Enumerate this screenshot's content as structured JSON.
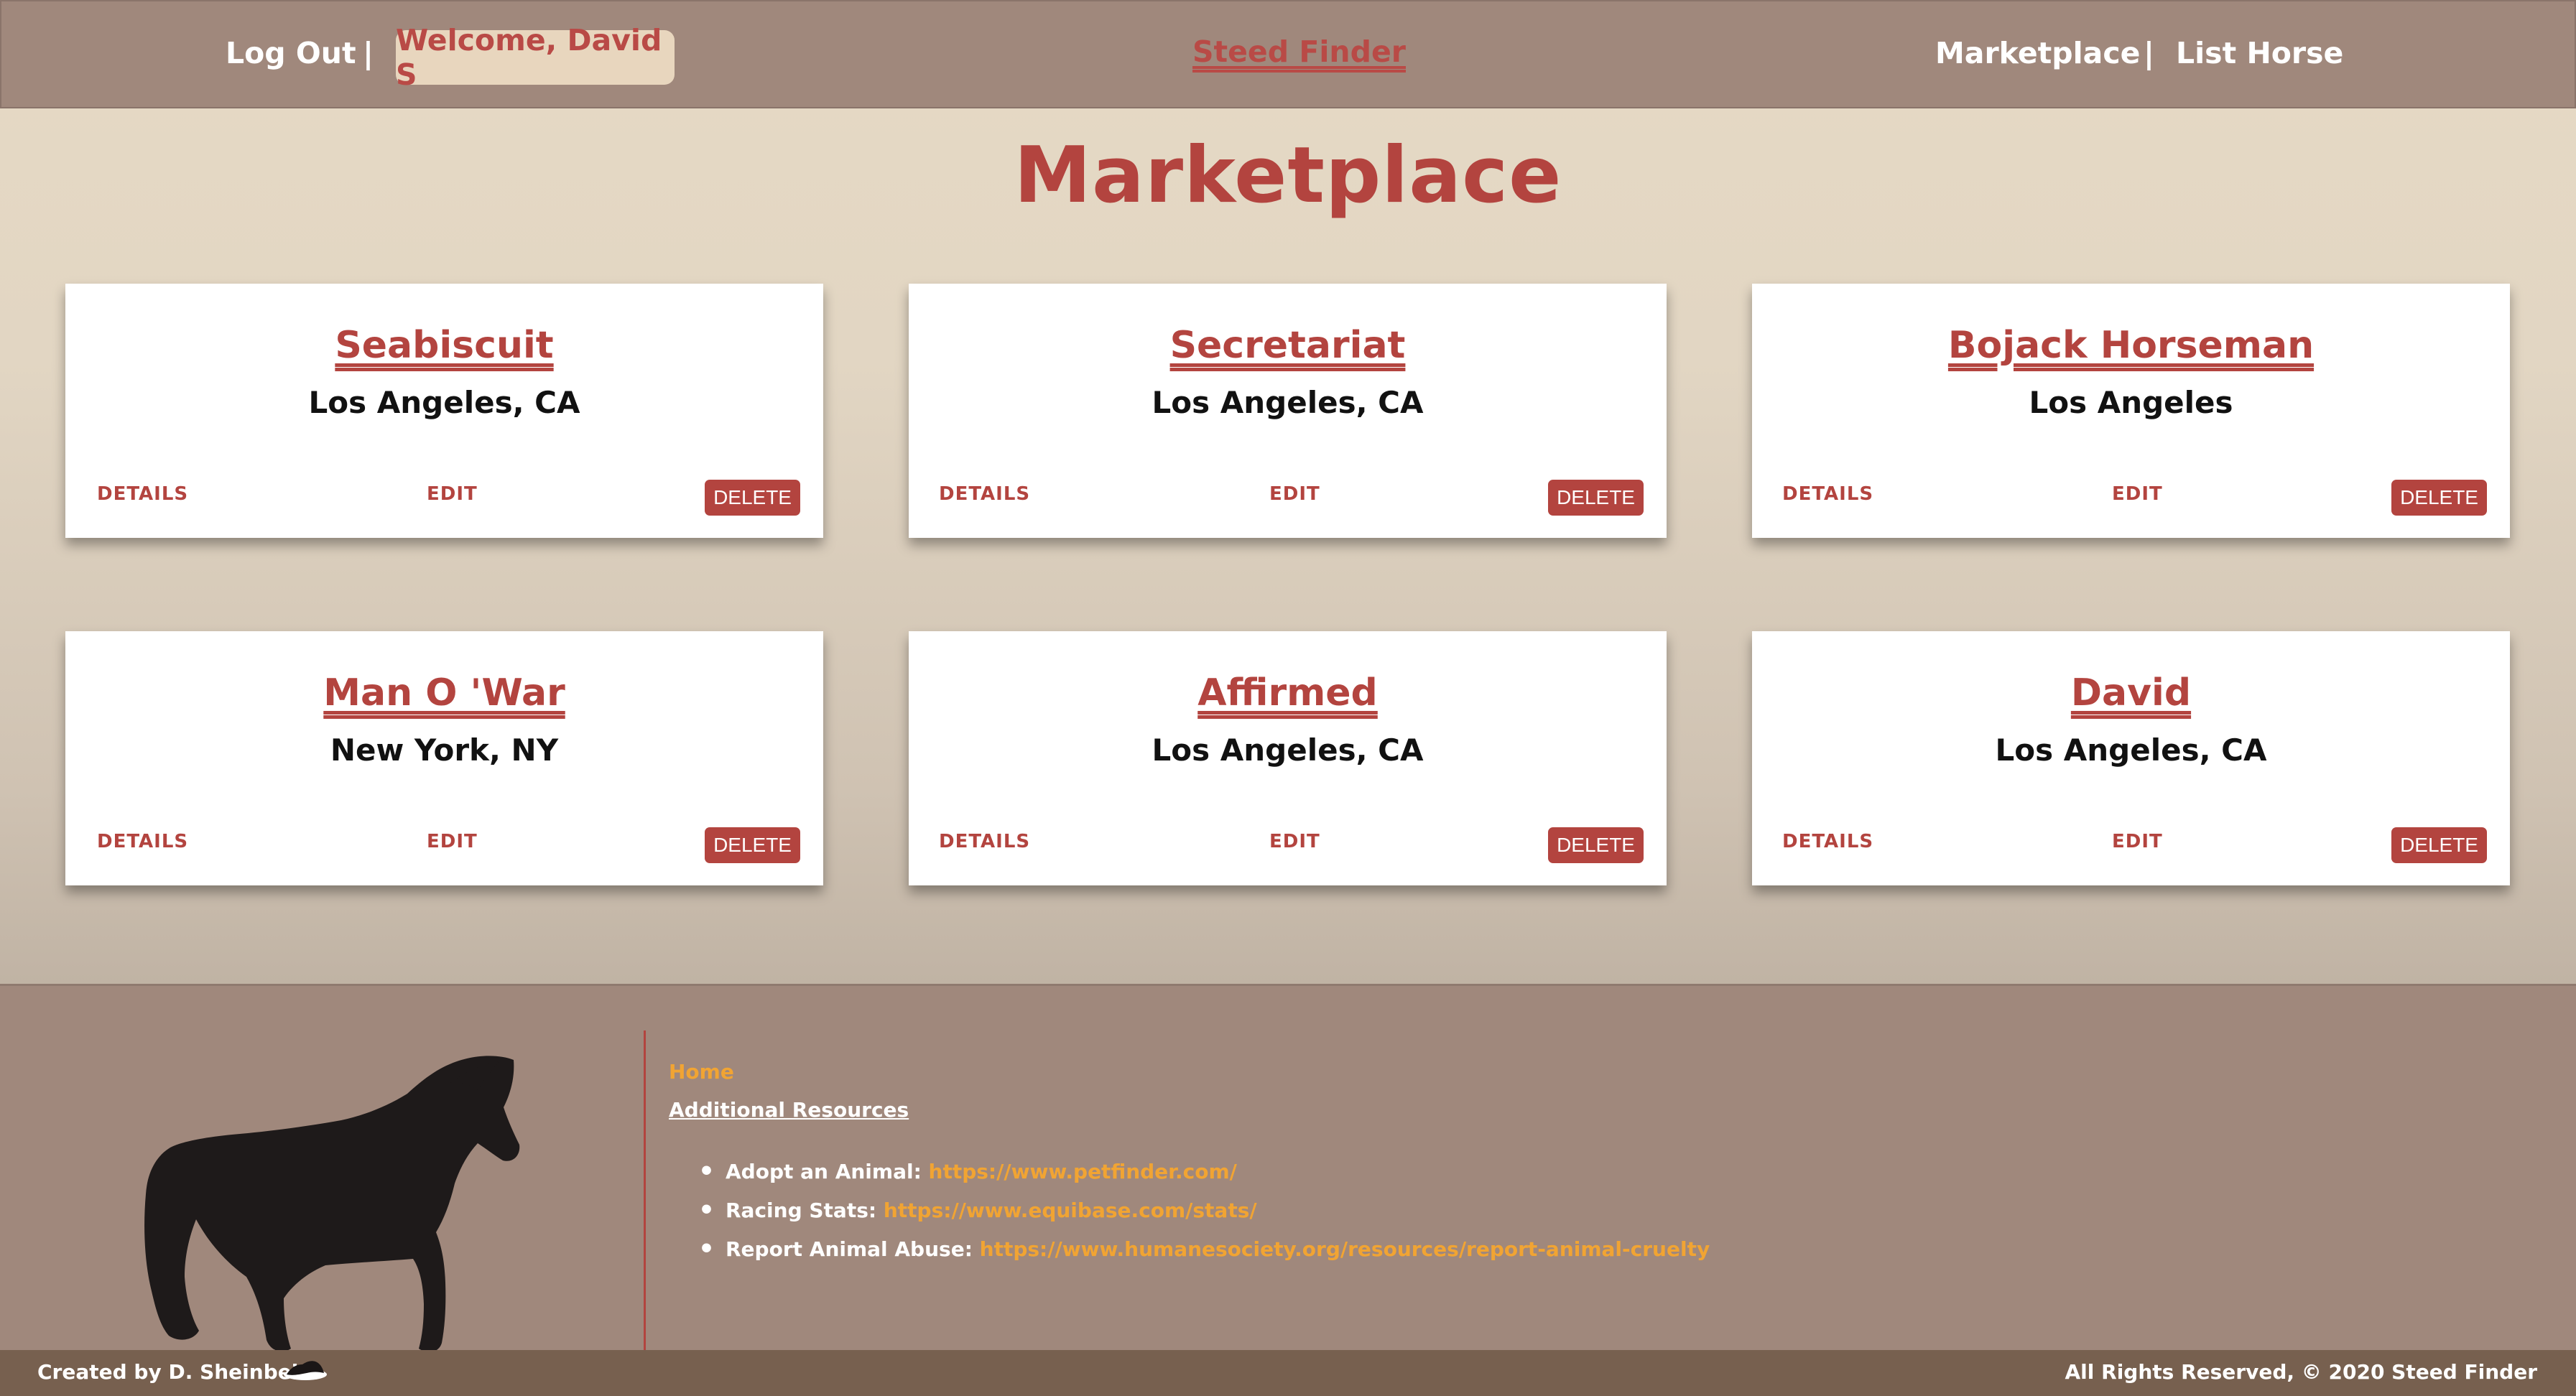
{
  "nav": {
    "logout": "Log Out",
    "separator": "|",
    "welcome": "Welcome, David S",
    "brand": "Steed Finder",
    "marketplace": "Marketplace",
    "list_horse": "List Horse"
  },
  "page": {
    "title": "Marketplace"
  },
  "card_actions": {
    "details": "DETAILS",
    "edit": "EDIT",
    "delete": "DELETE"
  },
  "horses": [
    {
      "name": "Seabiscuit",
      "location": "Los Angeles, CA"
    },
    {
      "name": "Secretariat",
      "location": "Los Angeles, CA"
    },
    {
      "name": "Bojack Horseman",
      "location": "Los Angeles"
    },
    {
      "name": "Man O 'War",
      "location": "New York, NY"
    },
    {
      "name": "Affirmed",
      "location": "Los Angeles, CA"
    },
    {
      "name": "David",
      "location": "Los Angeles, CA"
    }
  ],
  "footer": {
    "home": "Home",
    "resources_heading": "Additional Resources",
    "resources": [
      {
        "label": "Adopt an Animal: ",
        "url": "https://www.petfinder.com/"
      },
      {
        "label": "Racing Stats: ",
        "url": "https://www.equibase.com/stats/"
      },
      {
        "label": "Report Animal Abuse: ",
        "url": "https://www.humanesociety.org/resources/report-animal-cruelty"
      }
    ],
    "credit": "Created by D. Sheinbein",
    "rights": "All Rights Reserved, © 2020 Steed Finder"
  },
  "colors": {
    "nav_bg": "#a0887c",
    "accent": "#b3443f",
    "link_orange": "#f1a433",
    "bottom_bar": "#77604f"
  },
  "icons": {
    "footer_art": "horse-silhouette-icon",
    "credit_art": "mini-horse-icon"
  }
}
